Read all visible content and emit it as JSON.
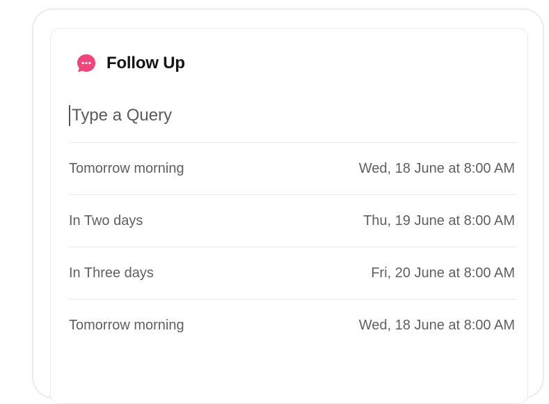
{
  "header": {
    "title": "Follow Up",
    "icon": "chat-bubble-icon",
    "icon_color": "#f0457a"
  },
  "query": {
    "placeholder": "Type a Query",
    "value": ""
  },
  "options": [
    {
      "label": "Tomorrow morning",
      "date": "Wed, 18 June at 8:00 AM"
    },
    {
      "label": "In Two days",
      "date": "Thu, 19 June at 8:00 AM"
    },
    {
      "label": "In Three days",
      "date": "Fri, 20 June at 8:00 AM"
    },
    {
      "label": "Tomorrow morning",
      "date": "Wed, 18 June at 8:00 AM"
    }
  ]
}
